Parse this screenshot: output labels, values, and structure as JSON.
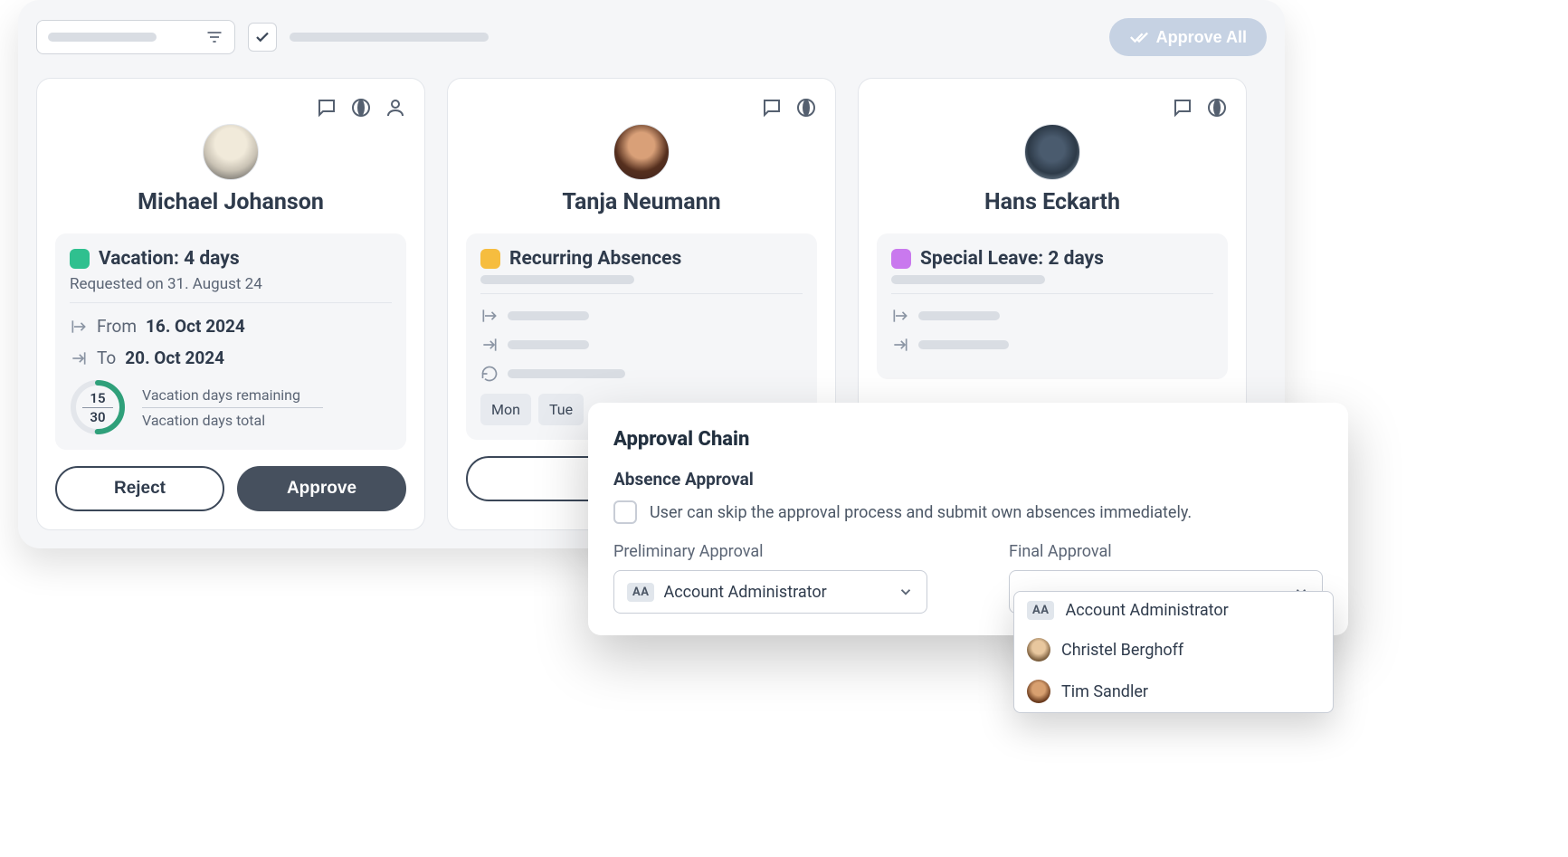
{
  "header": {
    "approve_all_label": "Approve All"
  },
  "cards": [
    {
      "name": "Michael Johanson",
      "type_label": "Vacation: 4 days",
      "requested_label": "Requested on 31. August 24",
      "from_label": "From",
      "from_value": "16. Oct 2024",
      "to_label": "To",
      "to_value": "20. Oct 2024",
      "gauge_remaining": "15",
      "gauge_total": "30",
      "stat1": "Vacation days remaining",
      "stat2": "Vacation days total",
      "reject_label": "Reject",
      "approve_label": "Approve"
    },
    {
      "name": "Tanja Neumann",
      "type_label": "Recurring Absences",
      "days": [
        "Mon",
        "Tue"
      ]
    },
    {
      "name": "Hans Eckarth",
      "type_label": "Special Leave: 2 days"
    }
  ],
  "modal": {
    "title": "Approval Chain",
    "section": "Absence Approval",
    "skip_text": "User can skip the approval process and submit own absences immediately.",
    "prelim_label": "Preliminary Approval",
    "final_label": "Final Approval",
    "prelim_value": "Account Administrator",
    "aa_badge": "AA",
    "options": [
      {
        "label": "Account Administrator",
        "badge": "AA"
      },
      {
        "label": "Christel Berghoff"
      },
      {
        "label": "Tim Sandler"
      }
    ]
  }
}
